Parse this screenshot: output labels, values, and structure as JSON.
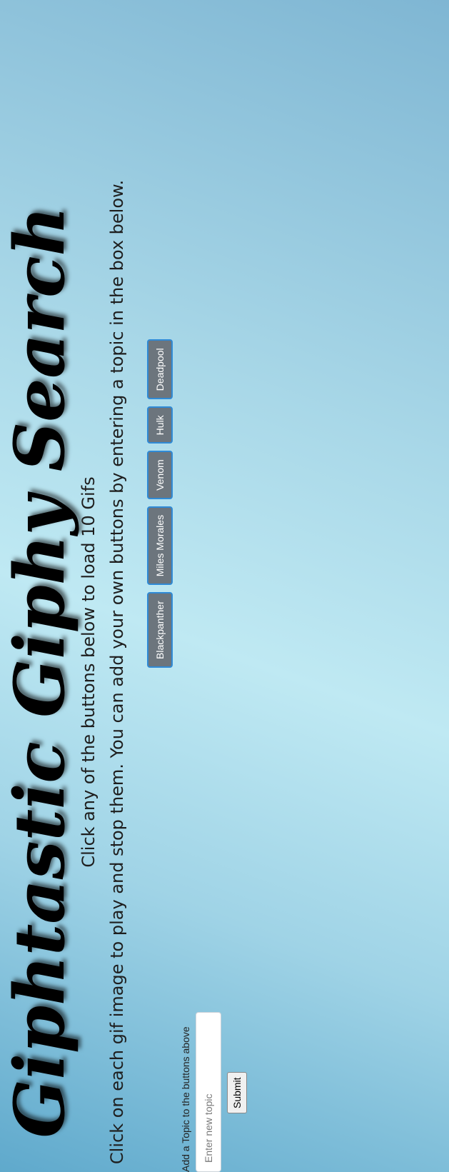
{
  "header": {
    "title": "Giphtastic Giphy Search",
    "instructions_line1": "Click any of the buttons below to load 10 Gifs",
    "instructions_line2": "Click on each gif image to play and stop them. You can add your own buttons by entering a topic in the box below."
  },
  "topics": [
    "Blackpanther",
    "Miles Morales",
    "Venom",
    "Hulk",
    "Deadpool"
  ],
  "form": {
    "label": "Add a Topic to the buttons above",
    "input_placeholder": "Enter new topic",
    "input_value": "",
    "submit_label": "Submit"
  },
  "colors": {
    "topic_button_bg": "#6c757d",
    "topic_button_border": "#2f8ad6",
    "background_light": "#bfe9f3",
    "background_dark": "#5fa9cc"
  }
}
